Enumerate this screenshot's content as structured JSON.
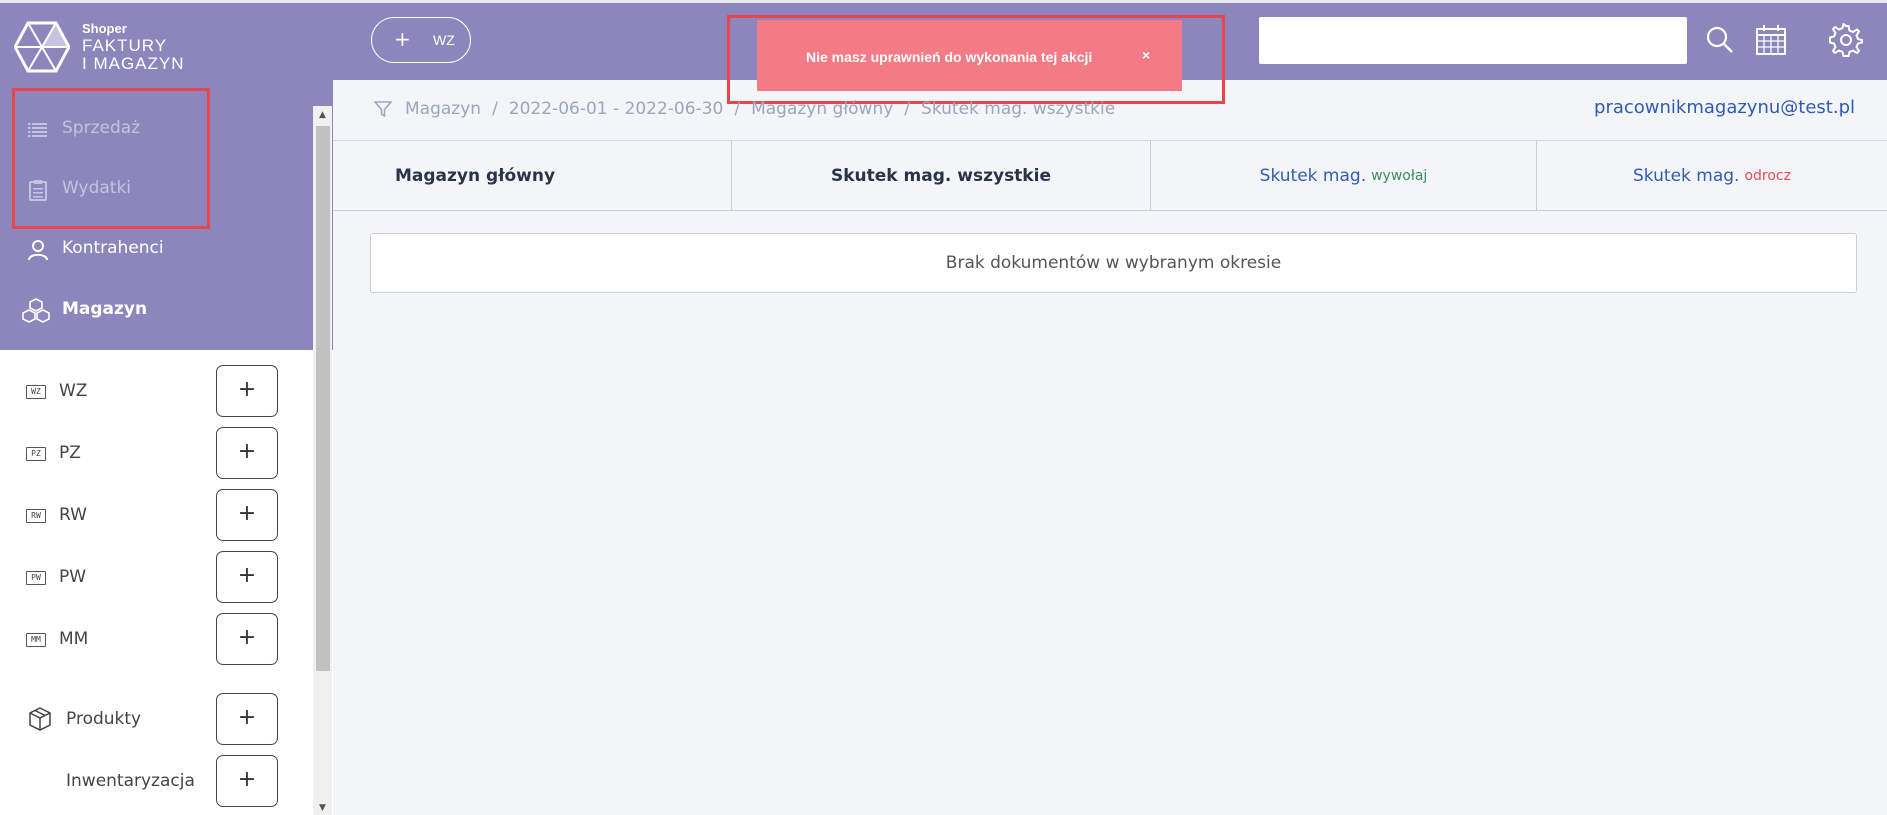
{
  "app": {
    "brand": "Shoper",
    "name_line1": "FAKTURY",
    "name_line2": "I MAGAZYN",
    "accent_color": "#8c86bc"
  },
  "sidebar": {
    "nav": [
      {
        "label": "Sprzedaż",
        "icon": "list-icon"
      },
      {
        "label": "Wydatki",
        "icon": "clipboard-icon"
      },
      {
        "label": "Kontrahenci",
        "icon": "user-icon"
      },
      {
        "label": "Magazyn",
        "icon": "boxes-icon"
      }
    ],
    "documents": [
      {
        "code": "WZ",
        "label": "WZ",
        "add": "+"
      },
      {
        "code": "PZ",
        "label": "PZ",
        "add": "+"
      },
      {
        "code": "RW",
        "label": "RW",
        "add": "+"
      },
      {
        "code": "PW",
        "label": "PW",
        "add": "+"
      },
      {
        "code": "MM",
        "label": "MM",
        "add": "+"
      }
    ],
    "products": {
      "label": "Produkty",
      "add": "+"
    },
    "inventory": {
      "label": "Inwentaryzacja",
      "add": "+"
    }
  },
  "header": {
    "new_plus": "+",
    "new_label": "WZ",
    "search_value": ""
  },
  "toast": {
    "message": "Nie masz uprawnień do wykonania tej akcji",
    "close": "×"
  },
  "breadcrumb": [
    "Magazyn",
    "2022-06-01 - 2022-06-30",
    "Magazyn główny",
    "Skutek mag. wszystkie"
  ],
  "breadcrumb_sep": "/",
  "user_email": "pracownikmagazynu@test.pl",
  "tabs": [
    {
      "label": "Magazyn główny",
      "sub": ""
    },
    {
      "label": "Skutek mag. wszystkie",
      "sub": ""
    },
    {
      "label": "Skutek mag.",
      "sub": "wywołaj"
    },
    {
      "label": "Skutek mag.",
      "sub": "odrocz"
    }
  ],
  "empty_message": "Brak dokumentów w wybranym okresie"
}
